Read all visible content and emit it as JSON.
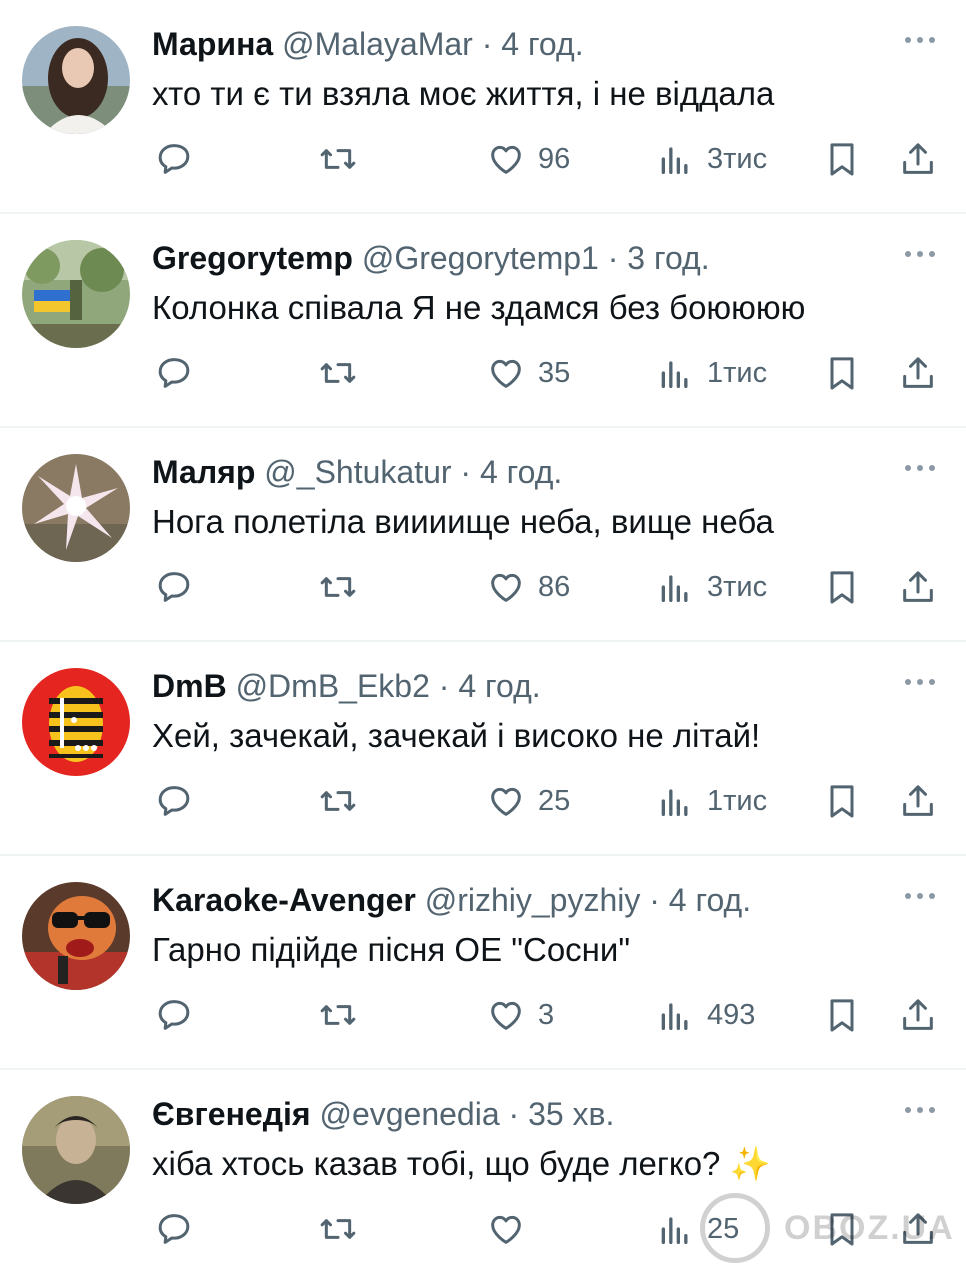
{
  "tweets": [
    {
      "name": "Марина",
      "handle": "@MalayaMar",
      "dot": "·",
      "time": "4 год.",
      "text": "хто ти є ти взяла моє життя, і не віддала",
      "likes": "96",
      "views": "3тис"
    },
    {
      "name": "Gregorytemp",
      "handle": "@Gregorytemp1",
      "dot": "·",
      "time": "3 год.",
      "text": "Колонка співала Я не здамся без боюююю",
      "likes": "35",
      "views": "1тис"
    },
    {
      "name": "Маляр",
      "handle": "@_Shtukatur",
      "dot": "·",
      "time": "4 год.",
      "text": "Нога полетіла виииище неба, вище неба",
      "likes": "86",
      "views": "3тис"
    },
    {
      "name": "DmB",
      "handle": "@DmB_Ekb2",
      "dot": "·",
      "time": "4 год.",
      "text": "Хей, зачекай, зачекай і високо не літай!",
      "likes": "25",
      "views": "1тис"
    },
    {
      "name": "Karaoke-Avenger",
      "handle": "@rizhiy_pyzhiy",
      "dot": "·",
      "time": "4 год.",
      "text": "Гарно підійде пісня ОЕ \"Сосни\"",
      "likes": "3",
      "views": "493"
    },
    {
      "name": "Євгенедія",
      "handle": "@evgenedia",
      "dot": "·",
      "time": "35 хв.",
      "text": "хіба хтось казав тобі, що буде легко? ✨",
      "likes": "",
      "views": "25"
    }
  ],
  "watermark": {
    "text": "OBOZ.UA"
  },
  "colors": {
    "text": "#0f1419",
    "secondary": "#536471",
    "divider": "#eff3f4"
  },
  "icons": [
    "reply-icon",
    "retweet-icon",
    "like-icon",
    "views-icon",
    "bookmark-icon",
    "share-icon",
    "more-icon"
  ]
}
